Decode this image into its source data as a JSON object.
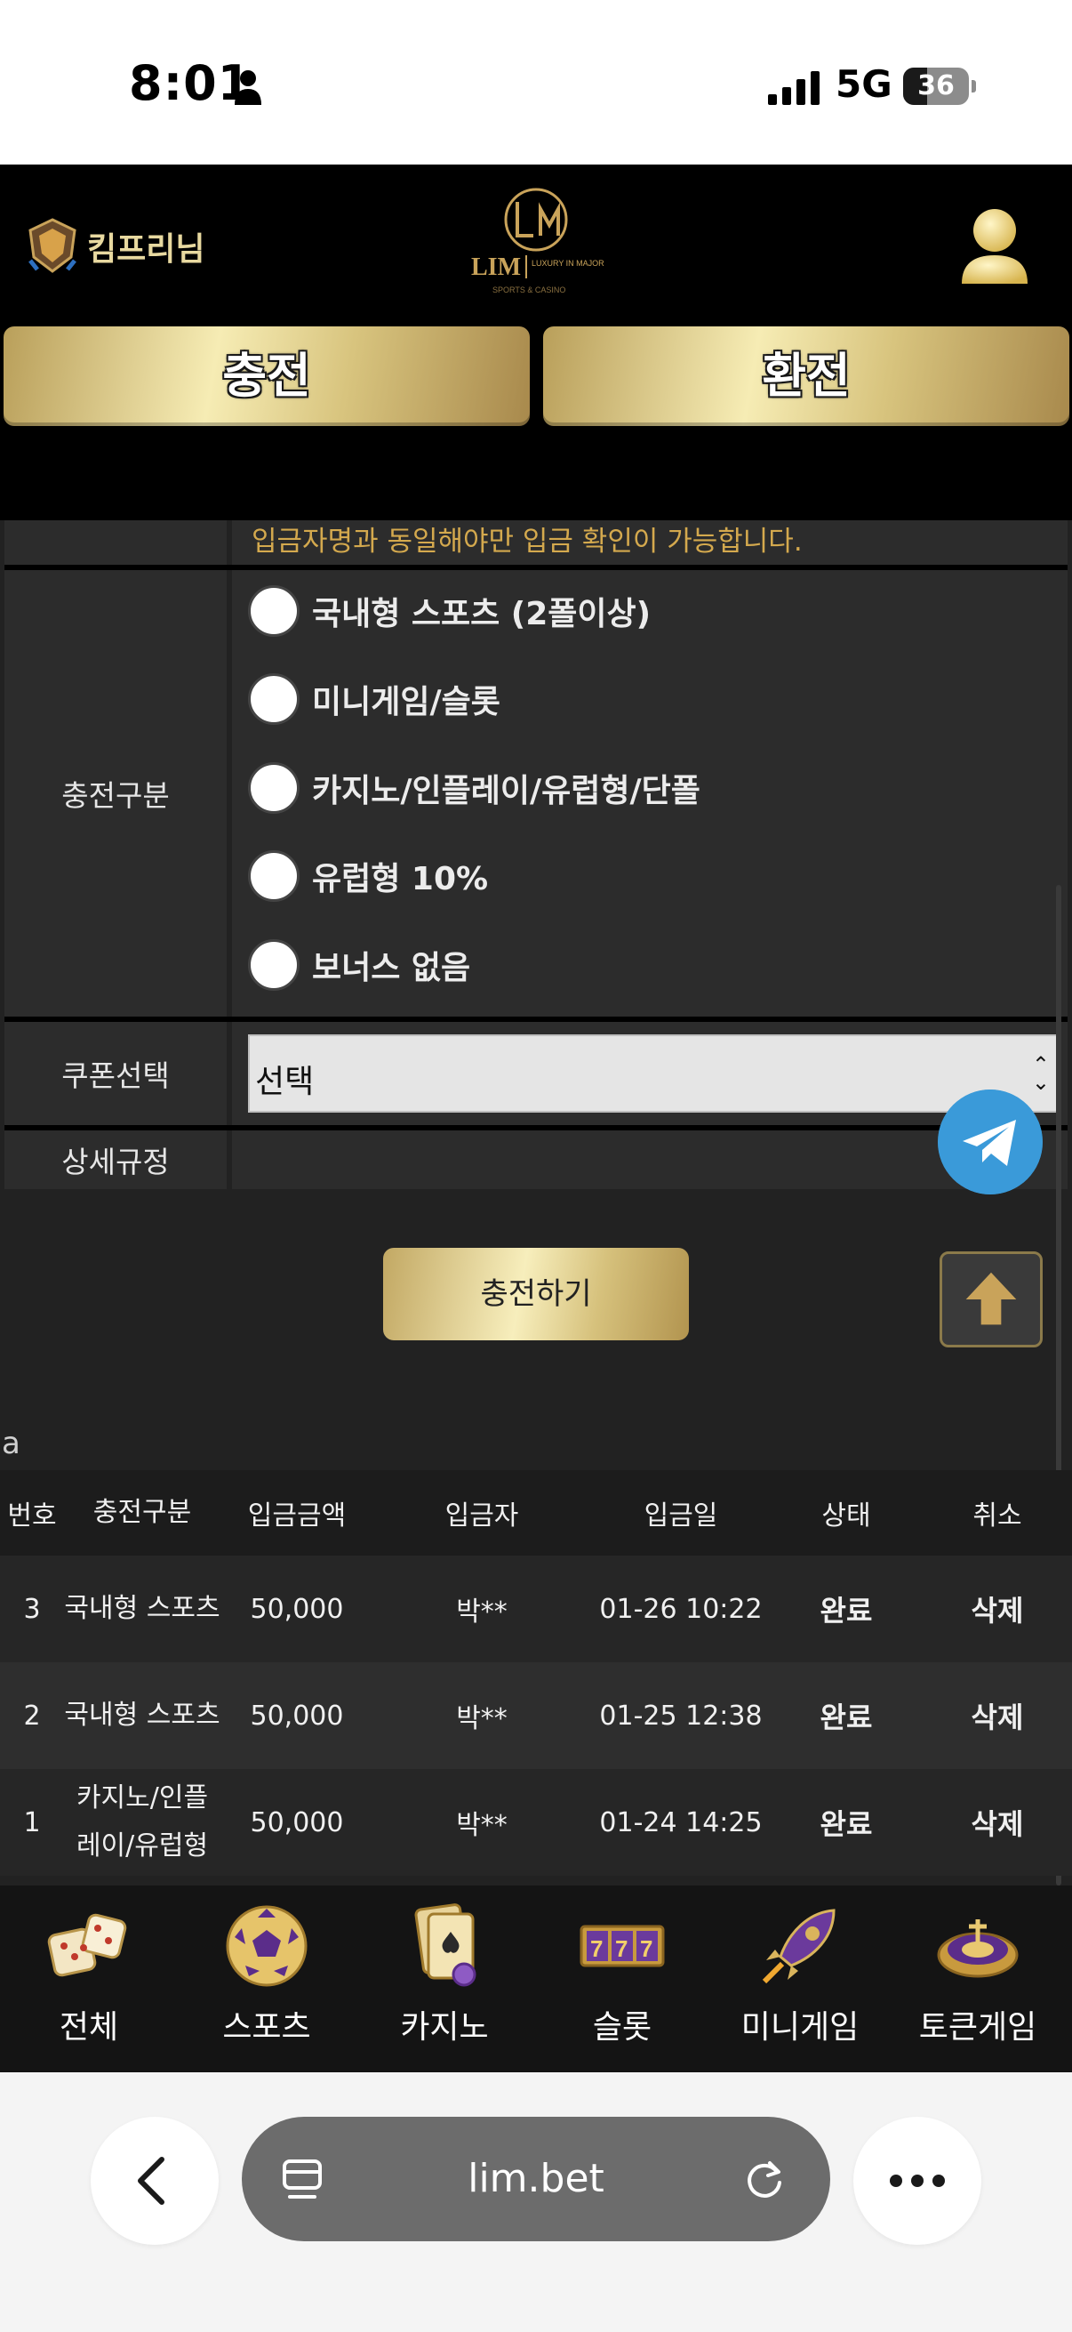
{
  "status_bar": {
    "time": "8:01",
    "network": "5G",
    "battery": "36",
    "battery_level": 0.36
  },
  "header": {
    "username": "킴프리님",
    "logo_text": "LIM",
    "logo_sub": "LUXURY IN MAJOR",
    "logo_tag": "SPORTS & CASINO",
    "charge_button": "충전",
    "exchange_button": "환전"
  },
  "form": {
    "notice": "입금자명과 동일해야만 입금 확인이 가능합니다.",
    "category_label": "충전구분",
    "options": [
      "국내형 스포츠 (2폴이상)",
      "미니게임/슬롯",
      "카지노/인플레이/유럽형/단폴",
      "유럽형 10%",
      "보너스 없음"
    ],
    "coupon_label": "쿠폰선택",
    "coupon_value": "선택",
    "rules_label": "상세규정",
    "submit_label": "충전하기"
  },
  "section_letter": "a",
  "history": {
    "columns": [
      "번호",
      "충전구분",
      "입금금액",
      "입금자",
      "입금일",
      "상태",
      "취소"
    ],
    "rows": [
      {
        "no": "3",
        "type": "국내형 스포츠",
        "amount": "50,000",
        "depositor": "박**",
        "date": "01-26 10:22",
        "status": "완료",
        "cancel": "삭제"
      },
      {
        "no": "2",
        "type": "국내형 스포츠",
        "amount": "50,000",
        "depositor": "박**",
        "date": "01-25 12:38",
        "status": "완료",
        "cancel": "삭제"
      },
      {
        "no": "1",
        "type": "카지노/인플레이/유럽형",
        "amount": "50,000",
        "depositor": "박**",
        "date": "01-24 14:25",
        "status": "완료",
        "cancel": "삭제"
      }
    ]
  },
  "bottom_nav": [
    {
      "label": "전체",
      "icon": "dice-icon"
    },
    {
      "label": "스포츠",
      "icon": "soccer-ball-icon"
    },
    {
      "label": "카지노",
      "icon": "playing-card-icon"
    },
    {
      "label": "슬롯",
      "icon": "slot-777-icon"
    },
    {
      "label": "미니게임",
      "icon": "rocket-icon"
    },
    {
      "label": "토큰게임",
      "icon": "roulette-icon"
    }
  ],
  "browser": {
    "url": "lim.bet"
  },
  "colors": {
    "gold": "#e9d88f",
    "accent_notice": "#d4a94e",
    "background": "#222222",
    "telegram": "#3a9ad9"
  }
}
